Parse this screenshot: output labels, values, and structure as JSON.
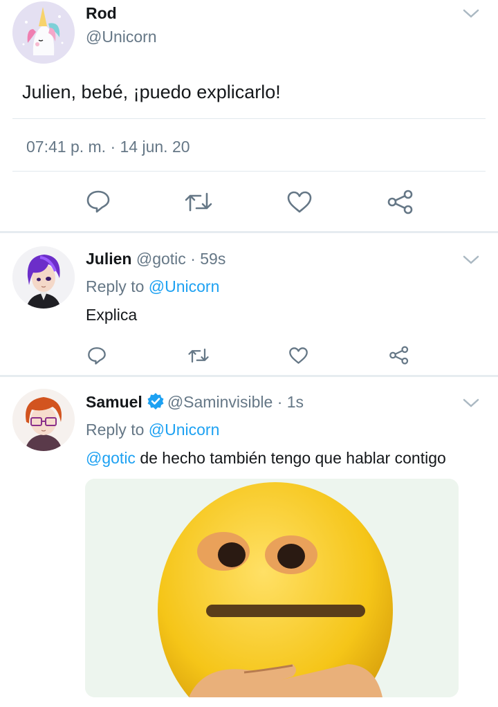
{
  "main_tweet": {
    "name": "Rod",
    "handle": "@Unicorn",
    "text": "Julien, bebé, ¡puedo explicarlo!",
    "timestamp": "07:41 p. m. · 14 jun. 20",
    "avatar_icon": "unicorn-avatar",
    "actions": [
      "reply-icon",
      "retweet-icon",
      "like-icon",
      "share-icon"
    ]
  },
  "replies": [
    {
      "name": "Julien",
      "handle": "@gotic",
      "time": "· 59s",
      "reply_prefix": "Reply to",
      "reply_to": "@Unicorn",
      "text": "Explica",
      "avatar_icon": "purple-hair-avatar"
    },
    {
      "name": "Samuel",
      "verified": true,
      "handle": "@Saminvisible",
      "time": "· 1s",
      "reply_prefix": "Reply to",
      "reply_to": "@Unicorn",
      "mention": "@gotic",
      "text": "de hecho también tengo que hablar contigo",
      "avatar_icon": "glasses-avatar",
      "media": "emoji-thinking-meme-image"
    }
  ],
  "colors": {
    "accent": "#1da1f2",
    "muted": "#657786",
    "divider": "#e1e8ed"
  }
}
